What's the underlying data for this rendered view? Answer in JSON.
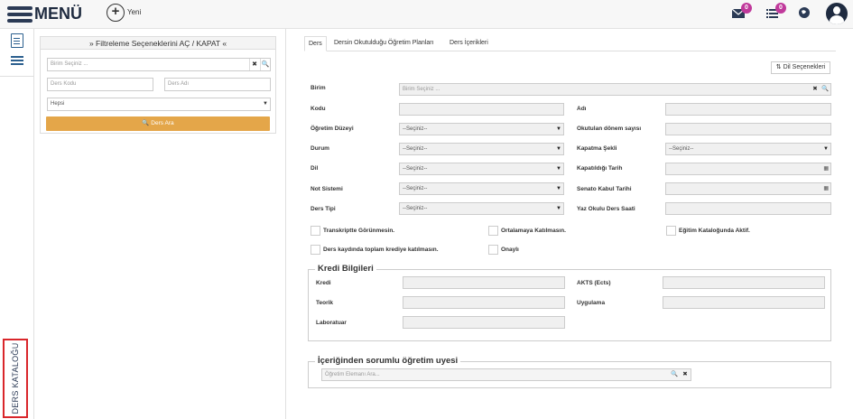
{
  "topbar": {
    "menu_title": "MENÜ",
    "new_label": "Yeni",
    "mail_badge": "0",
    "task_badge": "0"
  },
  "leftrail": {
    "vertical_tab_label": "DERS KATALOĞU"
  },
  "filter": {
    "header": "» Filtreleme Seçeneklerini AÇ / KAPAT «",
    "unit_placeholder": "Birim Seçiniz ...",
    "course_code_placeholder": "Ders Kodu",
    "course_name_placeholder": "Ders Adı",
    "status_selected": "Hepsi",
    "search_button": "Ders Ara"
  },
  "tabs": [
    {
      "label": "Ders"
    },
    {
      "label": "Dersin Okutulduğu Öğretim Planları"
    },
    {
      "label": "Ders İçerikleri"
    }
  ],
  "language_button": "Dil Seçenekleri",
  "form": {
    "birim_label": "Birim",
    "birim_placeholder": "Birim Seçiniz ...",
    "kodu_label": "Kodu",
    "adi_label": "Adı",
    "ogretim_duzeyi_label": "Öğretim Düzeyi",
    "ogretim_duzeyi_value": "--Seçiniz--",
    "okutulan_donem_label": "Okutulan dönem sayısı",
    "durum_label": "Durum",
    "durum_value": "--Seçiniz--",
    "kapatma_sekli_label": "Kapatma Şekli",
    "kapatma_sekli_value": "--Seçiniz--",
    "dil_label": "Dil",
    "dil_value": "--Seçiniz--",
    "kapatildigi_tarih_label": "Kapatıldığı Tarih",
    "not_sistemi_label": "Not Sistemi",
    "not_sistemi_value": "--Seçiniz--",
    "senato_kabul_label": "Senato Kabul Tarihi",
    "ders_tipi_label": "Ders Tipi",
    "ders_tipi_value": "--Seçiniz--",
    "yaz_okulu_label": "Yaz Okulu Ders Saati"
  },
  "checkboxes": {
    "transkript": "Transkriptte Görünmesin.",
    "ortalama": "Ortalamaya Katılmasın.",
    "egitim_katalog": "Eğitim Kataloğunda Aktif.",
    "ders_kaydi": "Ders kaydında toplam krediye katılmasın.",
    "onayli": "Onaylı"
  },
  "kredi": {
    "legend": "Kredi Bilgileri",
    "kredi_label": "Kredi",
    "akts_label": "AKTS (Ects)",
    "teorik_label": "Teorik",
    "uygulama_label": "Uygulama",
    "laboratuar_label": "Laboratuar"
  },
  "sorumlu": {
    "legend": "İçeriğinden sorumlu öğretim uyesi",
    "placeholder": "Öğretim Elemanı Ara..."
  }
}
